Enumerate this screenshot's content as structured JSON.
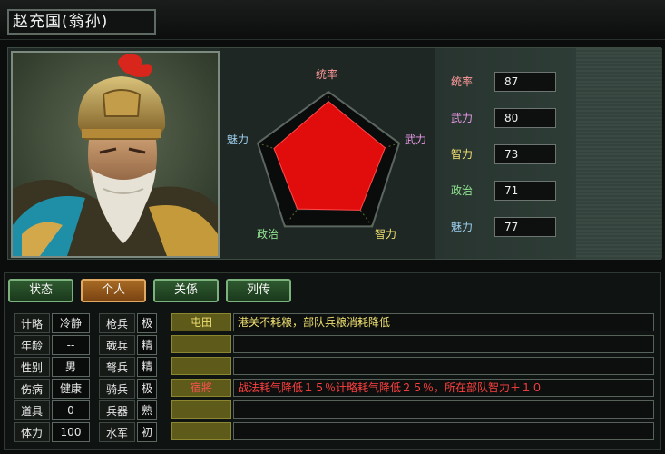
{
  "officer": {
    "name": "赵充国(翁孙)"
  },
  "radar": {
    "labels": [
      "统率",
      "武力",
      "智力",
      "政治",
      "魅力"
    ],
    "values": [
      87,
      80,
      73,
      71,
      77
    ],
    "max": 100,
    "fill_color": "#e10d0d"
  },
  "stats": [
    {
      "label": "统率",
      "value": "87",
      "color": "#ff9a9a"
    },
    {
      "label": "武力",
      "value": "80",
      "color": "#e89ae8"
    },
    {
      "label": "智力",
      "value": "73",
      "color": "#f0e070"
    },
    {
      "label": "政治",
      "value": "71",
      "color": "#8fe08f"
    },
    {
      "label": "魅力",
      "value": "77",
      "color": "#9ed0f0"
    }
  ],
  "tabs": [
    {
      "label": "状态",
      "active": false
    },
    {
      "label": "个人",
      "active": true
    },
    {
      "label": "关係",
      "active": false
    },
    {
      "label": "列传",
      "active": false
    }
  ],
  "attributes": [
    {
      "label": "计略",
      "value": "冷静"
    },
    {
      "label": "年龄",
      "value": "--"
    },
    {
      "label": "性别",
      "value": "男"
    },
    {
      "label": "伤病",
      "value": "健康"
    },
    {
      "label": "道具",
      "value": "0"
    },
    {
      "label": "体力",
      "value": "100"
    }
  ],
  "troops": [
    {
      "label": "枪兵",
      "value": "极"
    },
    {
      "label": "戟兵",
      "value": "精"
    },
    {
      "label": "弩兵",
      "value": "精"
    },
    {
      "label": "骑兵",
      "value": "极"
    },
    {
      "label": "兵器",
      "value": "熟"
    },
    {
      "label": "水军",
      "value": "初"
    }
  ],
  "skills": [
    {
      "name": "屯田",
      "desc": "港关不耗粮，部队兵粮消耗降低",
      "name_color": "#f0e070",
      "desc_color": "#f0e070"
    },
    {
      "name": "",
      "desc": "",
      "name_color": "#f0e070",
      "desc_color": "#f0e070"
    },
    {
      "name": "",
      "desc": "",
      "name_color": "#f0e070",
      "desc_color": "#f0e070"
    },
    {
      "name": "宿將",
      "desc": "战法耗气降低１５％计略耗气降低２５％，所在部队智力＋１０",
      "name_color": "#ff5050",
      "desc_color": "#ff4040"
    },
    {
      "name": "",
      "desc": "",
      "name_color": "#f0e070",
      "desc_color": "#f0e070"
    },
    {
      "name": "",
      "desc": "",
      "name_color": "#f0e070",
      "desc_color": "#f0e070"
    }
  ]
}
